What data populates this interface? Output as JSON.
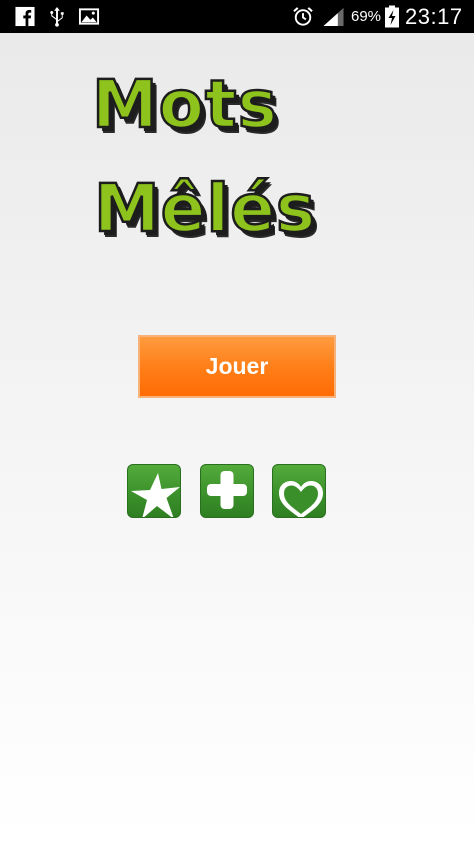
{
  "status_bar": {
    "battery_percent": "69%",
    "time": "23:17",
    "icons": [
      "facebook-icon",
      "usb-icon",
      "image-icon",
      "alarm-icon",
      "signal-icon",
      "battery-icon"
    ]
  },
  "logo": {
    "line1": "Mots",
    "line2": "Mêlés"
  },
  "main": {
    "play_label": "Jouer",
    "icon_buttons": [
      "star-icon",
      "plus-icon",
      "heart-icon"
    ]
  },
  "colors": {
    "logo_green": "#8ec21c",
    "play_orange": "#ff7d16",
    "icon_green": "#3a8f2a",
    "status_bar_bg": "#000000"
  }
}
